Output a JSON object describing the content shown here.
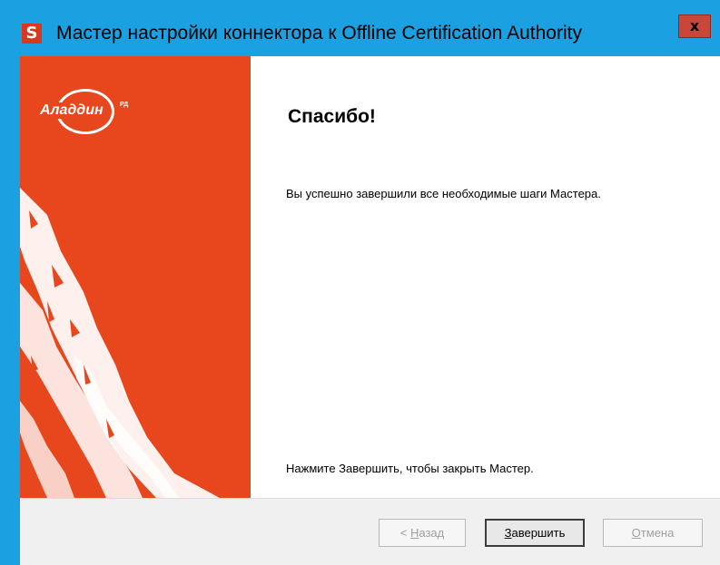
{
  "window": {
    "title": "Мастер настройки коннектора к Offline Certification Authority",
    "app_icon_letter": "S",
    "close_glyph": "x"
  },
  "banner": {
    "logo_text": "Аладдин",
    "logo_superscript": "РД",
    "background_color": "#e8461c"
  },
  "content": {
    "heading": "Спасибо!",
    "message": "Вы успешно завершили все необходимые шаги Мастера.",
    "finish_hint": "Нажмите Завершить, чтобы закрыть Мастер."
  },
  "buttons": {
    "back": {
      "prefix": "< ",
      "mnemonic": "Н",
      "rest": "азад",
      "enabled": false
    },
    "finish": {
      "mnemonic": "З",
      "rest": "авершить",
      "enabled": true
    },
    "cancel": {
      "mnemonic": "О",
      "rest": "тмена",
      "enabled": false
    }
  }
}
